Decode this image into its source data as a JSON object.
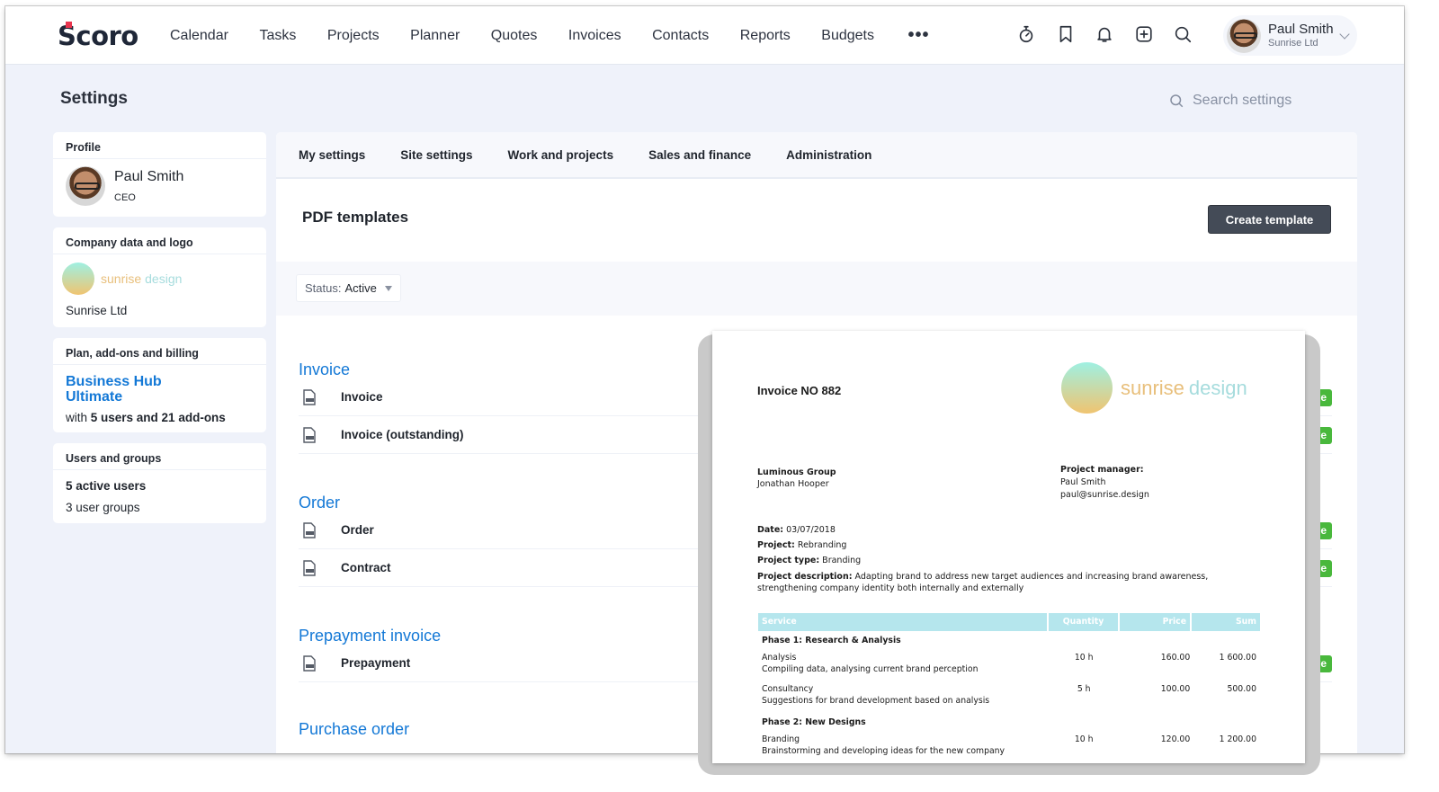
{
  "app": {
    "brand": "Scoro"
  },
  "nav": {
    "items": [
      "Calendar",
      "Tasks",
      "Projects",
      "Planner",
      "Quotes",
      "Invoices",
      "Contacts",
      "Reports",
      "Budgets"
    ],
    "more": "•••",
    "icons": [
      "timer-icon",
      "bookmark-icon",
      "bell-icon",
      "add-icon",
      "search-icon"
    ],
    "user": {
      "name": "Paul Smith",
      "company": "Sunrise Ltd"
    }
  },
  "settings": {
    "title": "Settings",
    "search_placeholder": "Search settings"
  },
  "sidebar": {
    "profile": {
      "heading": "Profile",
      "name": "Paul Smith",
      "role": "CEO"
    },
    "company": {
      "heading": "Company data and logo",
      "logo_word1": "sunrise",
      "logo_word2": "design",
      "name": "Sunrise Ltd"
    },
    "plan": {
      "heading": "Plan, add-ons and billing",
      "plan_line1": "Business Hub",
      "plan_line2": "Ultimate",
      "detail_prefix": "with ",
      "detail_bold": "5 users and 21 add-ons"
    },
    "users": {
      "heading": "Users and groups",
      "active": "5 active users",
      "groups": "3 user groups"
    }
  },
  "tabs": [
    "My settings",
    "Site settings",
    "Work and projects",
    "Sales and finance",
    "Administration"
  ],
  "pdf_templates": {
    "title": "PDF templates",
    "create_button": "Create template",
    "filter": {
      "label": "Status:",
      "value": "Active"
    },
    "groups": [
      {
        "title": "Invoice",
        "items": [
          {
            "name": "Invoice",
            "status": "Active"
          },
          {
            "name": "Invoice (outstanding)",
            "status": "Active"
          }
        ]
      },
      {
        "title": "Order",
        "items": [
          {
            "name": "Order",
            "status": "Active"
          },
          {
            "name": "Contract",
            "status": "Active"
          }
        ]
      },
      {
        "title": "Prepayment invoice",
        "items": [
          {
            "name": "Prepayment",
            "status": "Active"
          }
        ]
      },
      {
        "title": "Purchase order",
        "items": []
      }
    ]
  },
  "invoice_preview": {
    "number": "Invoice NO 882",
    "logo_word1": "sunrise",
    "logo_word2": "design",
    "client_company": "Luminous Group",
    "client_contact": "Jonathan Hooper",
    "pm_label": "Project manager:",
    "pm_name": "Paul Smith",
    "pm_email": "paul@sunrise.design",
    "date_label": "Date:",
    "date": "03/07/2018",
    "project_label": "Project:",
    "project": "Rebranding",
    "type_label": "Project type:",
    "type": "Branding",
    "desc_label": "Project description:",
    "desc": "Adapting brand to address new target audiences and increasing brand awareness, strengthening company identity both internally and externally",
    "table": {
      "headers": [
        "Service",
        "Quantity",
        "Price",
        "Sum"
      ],
      "phases": [
        {
          "title": "Phase 1: Research & Analysis",
          "items": [
            {
              "service": "Analysis",
              "description": "Compiling data, analysing current brand perception",
              "qty": "10 h",
              "price": "160.00",
              "sum": "1 600.00"
            },
            {
              "service": "Consultancy",
              "description": "Suggestions for brand development based on analysis",
              "qty": "5 h",
              "price": "100.00",
              "sum": "500.00"
            }
          ]
        },
        {
          "title": "Phase 2: New Designs",
          "items": [
            {
              "service": "Branding",
              "description": "Brainstorming and developing ideas for the new company",
              "qty": "10 h",
              "price": "120.00",
              "sum": "1 200.00"
            }
          ]
        }
      ]
    }
  },
  "colors": {
    "accent": "#1378d6",
    "active_badge": "#49b83c",
    "button_dark": "#444b57",
    "page_bg": "#eff2fa",
    "table_header": "#b5e6ed"
  }
}
